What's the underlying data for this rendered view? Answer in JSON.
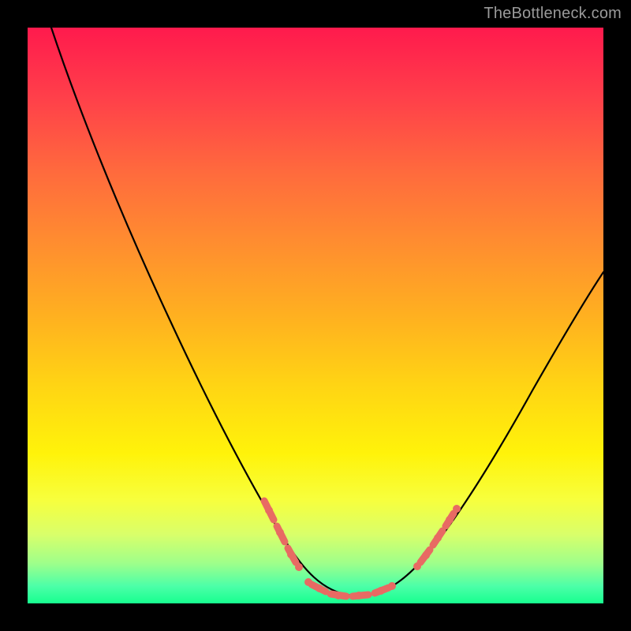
{
  "watermark": "TheBottleneck.com",
  "colors": {
    "background": "#000000",
    "gradient_top": "#ff1a4d",
    "gradient_bottom": "#17ff8f",
    "curve": "#000000",
    "highlight": "#e86a63"
  },
  "chart_data": {
    "type": "line",
    "title": "",
    "xlabel": "",
    "ylabel": "",
    "xlim": [
      0,
      100
    ],
    "ylim": [
      0,
      100
    ],
    "grid": false,
    "legend": false,
    "series": [
      {
        "name": "bottleneck-curve",
        "x": [
          4,
          8,
          12,
          16,
          20,
          24,
          28,
          32,
          36,
          40,
          44,
          47,
          50,
          53,
          56,
          59,
          62,
          66,
          70,
          74,
          78,
          82,
          86,
          90,
          94,
          98,
          100
        ],
        "y": [
          100,
          92,
          84,
          76,
          68,
          60,
          52,
          44,
          36,
          28,
          20,
          14,
          9,
          5,
          3,
          2,
          2,
          3,
          6,
          11,
          18,
          26,
          34,
          42,
          49,
          55,
          58
        ]
      }
    ],
    "annotations": [
      {
        "name": "highlight-left-descent",
        "type": "segment",
        "x_range": [
          40,
          47
        ],
        "y_range": [
          28,
          14
        ]
      },
      {
        "name": "highlight-valley",
        "type": "segment",
        "x_range": [
          50,
          62
        ],
        "y_range": [
          2,
          9
        ]
      },
      {
        "name": "highlight-right-rise",
        "type": "segment",
        "x_range": [
          66,
          72
        ],
        "y_range": [
          3,
          9
        ]
      }
    ]
  }
}
